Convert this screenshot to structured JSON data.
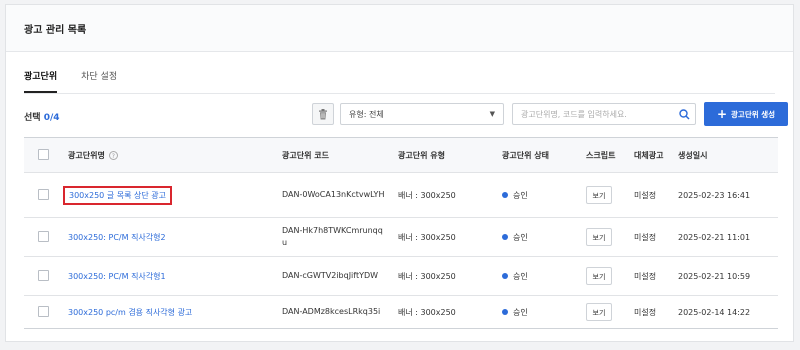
{
  "page": {
    "title": "광고 관리 목록"
  },
  "tabs": [
    {
      "label": "광고단위",
      "active": true
    },
    {
      "label": "차단 설정",
      "active": false
    }
  ],
  "toolbar": {
    "selection_prefix": "선택",
    "selection_count": "0/4",
    "type_filter": "유형: 전체",
    "search_placeholder": "광고단위명, 코드를 입력하세요.",
    "create_label": "광고단위 생성",
    "create_plus": "+"
  },
  "table": {
    "columns": [
      "광고단위명",
      "광고단위 코드",
      "광고단위 유형",
      "광고단위 상태",
      "스크립트",
      "대체광고",
      "생성일시"
    ],
    "help_glyph": "?",
    "view_label": "보기",
    "rows": [
      {
        "name": "300x250 글 목록 상단 광고",
        "code": "DAN-0WoCA13nKctvwLYH",
        "type": "배너 : 300x250",
        "status": "승인",
        "fallback": "미설정",
        "created": "2025-02-23 16:41"
      },
      {
        "name": "300x250: PC/M 직사각형2",
        "code": "DAN-Hk7h8TWKCmrunqqu",
        "type": "배너 : 300x250",
        "status": "승인",
        "fallback": "미설정",
        "created": "2025-02-21 11:01"
      },
      {
        "name": "300x250: PC/M 직사각형1",
        "code": "DAN-cGWTV2ibqJiftYDW",
        "type": "배너 : 300x250",
        "status": "승인",
        "fallback": "미설정",
        "created": "2025-02-21 10:59"
      },
      {
        "name": "300x250 pc/m 겸용 직사각형 광고",
        "code": "DAN-ADMz8kcesLRkq35i",
        "type": "배너 : 300x250",
        "status": "승인",
        "fallback": "미설정",
        "created": "2025-02-14 14:22"
      }
    ]
  },
  "colors": {
    "accent": "#2c6bd9",
    "status_approved": "#2c6bd9",
    "highlight": "#d9262e"
  },
  "icons": {
    "trash": "trash-icon",
    "search": "search-icon",
    "caret": "chevron-down-icon"
  }
}
